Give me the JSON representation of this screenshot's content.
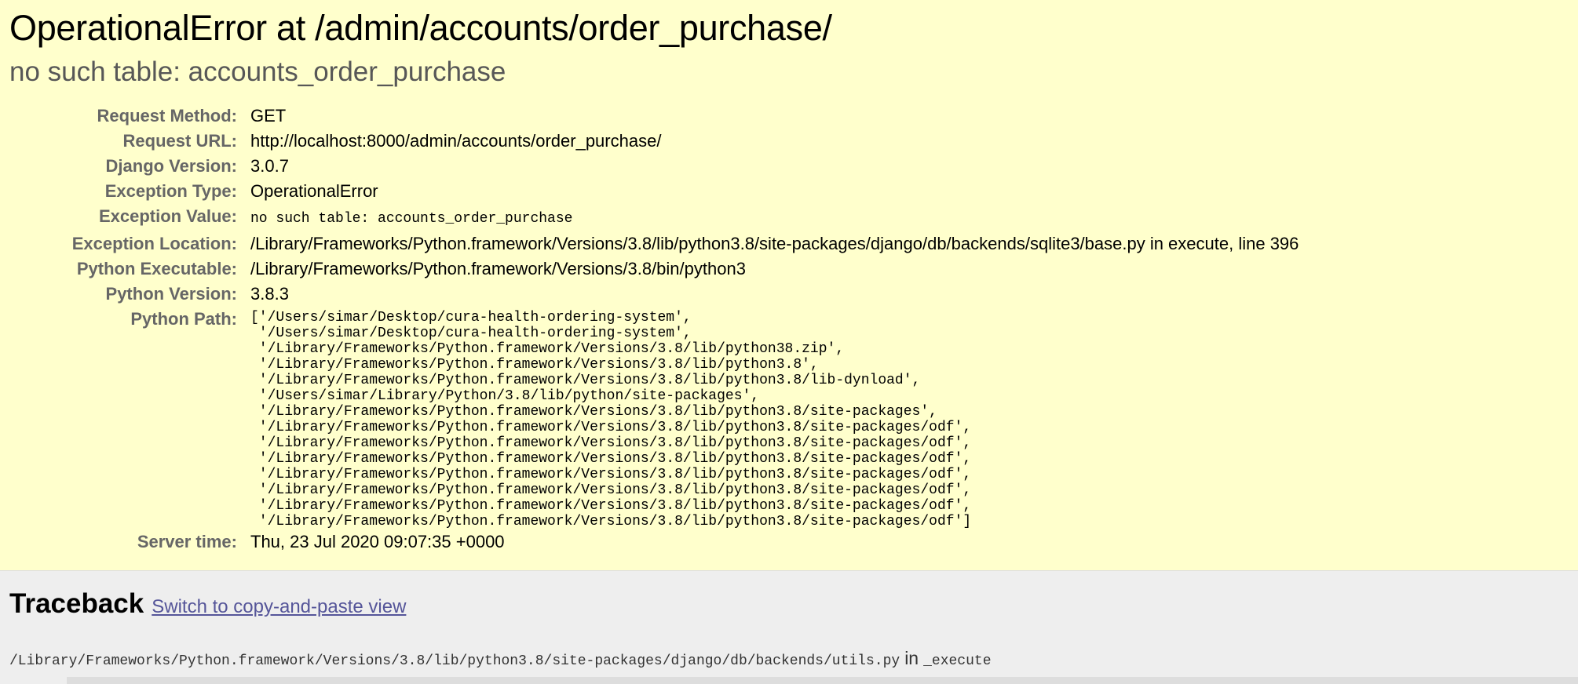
{
  "summary": {
    "title": "OperationalError at /admin/accounts/order_purchase/",
    "subtitle": "no such table: accounts_order_purchase",
    "meta": {
      "request_method": {
        "label": "Request Method:",
        "value": "GET"
      },
      "request_url": {
        "label": "Request URL:",
        "value": "http://localhost:8000/admin/accounts/order_purchase/"
      },
      "django_version": {
        "label": "Django Version:",
        "value": "3.0.7"
      },
      "exception_type": {
        "label": "Exception Type:",
        "value": "OperationalError"
      },
      "exception_value": {
        "label": "Exception Value:",
        "value": "no such table: accounts_order_purchase"
      },
      "exception_location": {
        "label": "Exception Location:",
        "value": "/Library/Frameworks/Python.framework/Versions/3.8/lib/python3.8/site-packages/django/db/backends/sqlite3/base.py in execute, line 396"
      },
      "python_executable": {
        "label": "Python Executable:",
        "value": "/Library/Frameworks/Python.framework/Versions/3.8/bin/python3"
      },
      "python_version": {
        "label": "Python Version:",
        "value": "3.8.3"
      },
      "python_path": {
        "label": "Python Path:",
        "value": "['/Users/simar/Desktop/cura-health-ordering-system',\n '/Users/simar/Desktop/cura-health-ordering-system',\n '/Library/Frameworks/Python.framework/Versions/3.8/lib/python38.zip',\n '/Library/Frameworks/Python.framework/Versions/3.8/lib/python3.8',\n '/Library/Frameworks/Python.framework/Versions/3.8/lib/python3.8/lib-dynload',\n '/Users/simar/Library/Python/3.8/lib/python/site-packages',\n '/Library/Frameworks/Python.framework/Versions/3.8/lib/python3.8/site-packages',\n '/Library/Frameworks/Python.framework/Versions/3.8/lib/python3.8/site-packages/odf',\n '/Library/Frameworks/Python.framework/Versions/3.8/lib/python3.8/site-packages/odf',\n '/Library/Frameworks/Python.framework/Versions/3.8/lib/python3.8/site-packages/odf',\n '/Library/Frameworks/Python.framework/Versions/3.8/lib/python3.8/site-packages/odf',\n '/Library/Frameworks/Python.framework/Versions/3.8/lib/python3.8/site-packages/odf',\n '/Library/Frameworks/Python.framework/Versions/3.8/lib/python3.8/site-packages/odf',\n '/Library/Frameworks/Python.framework/Versions/3.8/lib/python3.8/site-packages/odf']"
      },
      "server_time": {
        "label": "Server time:",
        "value": "Thu, 23 Jul 2020 09:07:35 +0000"
      }
    }
  },
  "traceback": {
    "title": "Traceback",
    "switch_link": "Switch to copy-and-paste view",
    "frame": {
      "filename": "/Library/Frameworks/Python.framework/Versions/3.8/lib/python3.8/site-packages/django/db/backends/utils.py",
      "in_word": "in",
      "function": "_execute"
    }
  },
  "colors": {
    "summary_bg": "#ffffcc",
    "page_bg": "#eeeeee",
    "label": "#666666",
    "link": "#555599"
  }
}
